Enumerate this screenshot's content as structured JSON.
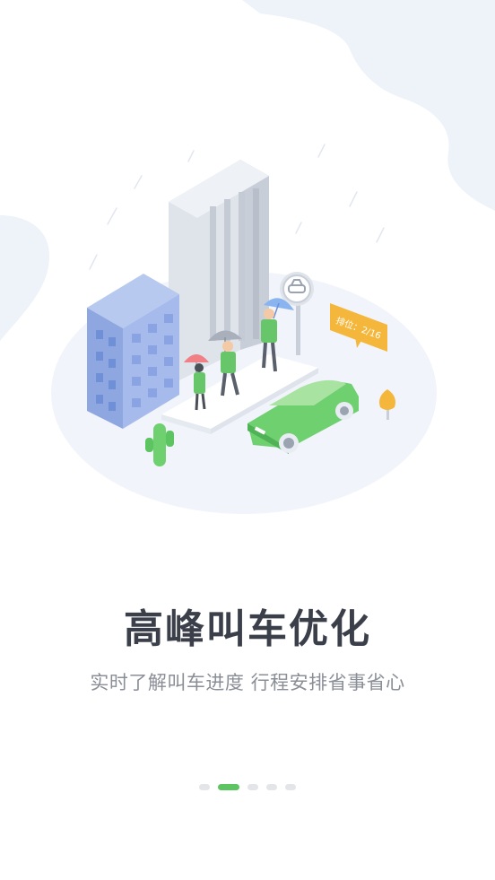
{
  "onboarding": {
    "title": "高峰叫车优化",
    "subtitle": "实时了解叫车进度 行程安排省事省心",
    "queue_badge": "排位：2/16",
    "page_count": 5,
    "active_page": 2
  },
  "colors": {
    "accent_green": "#5cc461",
    "title_text": "#3b3f4a",
    "subtitle_text": "#8a8e96",
    "badge_orange": "#f5b73b",
    "background_blob": "#eef3fa"
  },
  "icons": {
    "bus_stop_sign": "car-icon"
  }
}
